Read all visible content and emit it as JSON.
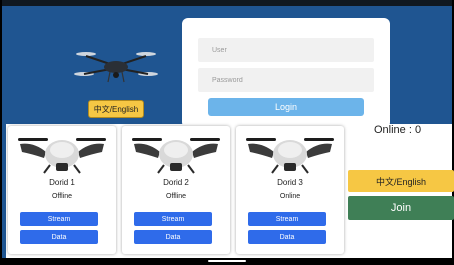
{
  "login": {
    "user_placeholder": "User",
    "password_placeholder": "Password",
    "login_label": "Login",
    "language_label": "中文/English"
  },
  "drones": [
    {
      "name": "Dorid 1",
      "status": "Offline",
      "stream_label": "Stream",
      "data_label": "Data"
    },
    {
      "name": "Dorid 2",
      "status": "Offline",
      "stream_label": "Stream",
      "data_label": "Data"
    },
    {
      "name": "Dorid 3",
      "status": "Online",
      "stream_label": "Stream",
      "data_label": "Data"
    }
  ],
  "sidebar": {
    "online_text": "Online : 0",
    "language_label": "中文/English",
    "join_label": "Join"
  },
  "colors": {
    "brand_blue": "#1f5591",
    "button_blue": "#2f6bea",
    "login_blue": "#6cb4ea",
    "language_yellow": "#f6c744",
    "join_green": "#3f7f56"
  },
  "icons": [
    "drone-icon"
  ]
}
